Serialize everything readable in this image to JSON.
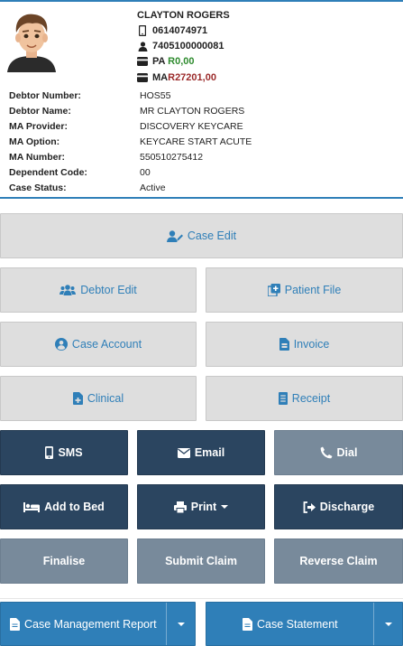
{
  "patient": {
    "name": "CLAYTON ROGERS",
    "phone": "0614074971",
    "id_number": "7405100000081",
    "pa_label": "PA",
    "pa_currency": "R",
    "pa_amount": "0,00",
    "ma_label": "MA",
    "ma_currency": "R",
    "ma_amount": "27201,00"
  },
  "details": [
    {
      "label": "Debtor Number:",
      "value": "HOS55"
    },
    {
      "label": "Debtor Name:",
      "value": "MR CLAYTON ROGERS"
    },
    {
      "label": "MA Provider:",
      "value": "DISCOVERY KEYCARE"
    },
    {
      "label": "MA Option:",
      "value": "KEYCARE START ACUTE"
    },
    {
      "label": "MA Number:",
      "value": "550510275412"
    },
    {
      "label": "Dependent Code:",
      "value": "00"
    },
    {
      "label": "Case Status:",
      "value": "Active"
    }
  ],
  "buttons": {
    "case_edit": "Case Edit",
    "debtor_edit": "Debtor Edit",
    "patient_file": "Patient File",
    "case_account": "Case Account",
    "invoice": "Invoice",
    "clinical": "Clinical",
    "receipt": "Receipt",
    "sms": "SMS",
    "email": "Email",
    "dial": "Dial",
    "add_to_bed": "Add to Bed",
    "print": "Print",
    "discharge": "Discharge",
    "finalise": "Finalise",
    "submit_claim": "Submit Claim",
    "reverse_claim": "Reverse Claim",
    "case_management_report": "Case Management Report",
    "case_statement": "Case Statement"
  },
  "colors": {
    "accent": "#2f7fb8",
    "dark_button": "#2b4560",
    "grey_button": "#788a9b",
    "light_button": "#dedede",
    "pa_amount": "#2e8b2e",
    "ma_amount": "#9b2a2a"
  }
}
